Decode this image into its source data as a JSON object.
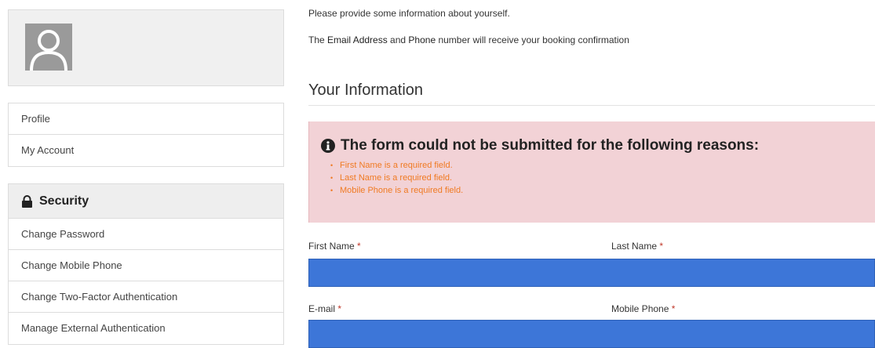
{
  "sidebar": {
    "profile_items": [
      {
        "label": "Profile"
      },
      {
        "label": "My Account"
      }
    ],
    "security": {
      "title": "Security",
      "items": [
        {
          "label": "Change Password"
        },
        {
          "label": "Change Mobile Phone"
        },
        {
          "label": "Change Two-Factor Authentication"
        },
        {
          "label": "Manage External Authentication"
        }
      ]
    }
  },
  "main": {
    "intro_line1": "Please provide some information about yourself.",
    "intro_line2": {
      "pre": "The ",
      "email": "Email Address",
      "mid": " and ",
      "phone": "Phone",
      "post": " number will receive your booking confirmation"
    },
    "section_title": "Your Information",
    "alert": {
      "title": "The form could not be submitted for the following reasons:",
      "errors": [
        "First Name is a required field.",
        "Last Name is a required field.",
        "Mobile Phone is a required field."
      ],
      "colors": {
        "background": "#f2d2d6",
        "error_text": "#f07a22"
      }
    },
    "form": {
      "required_marker": "*",
      "first_name_label": "First Name",
      "last_name_label": "Last Name",
      "email_label": "E-mail",
      "mobile_phone_label": "Mobile Phone",
      "first_name_value": "",
      "email_value": "",
      "input_color": "#3d76d8"
    }
  },
  "icons": {
    "avatar": "user-silhouette-icon",
    "security": "lock-icon",
    "alert": "info-circle-icon"
  }
}
